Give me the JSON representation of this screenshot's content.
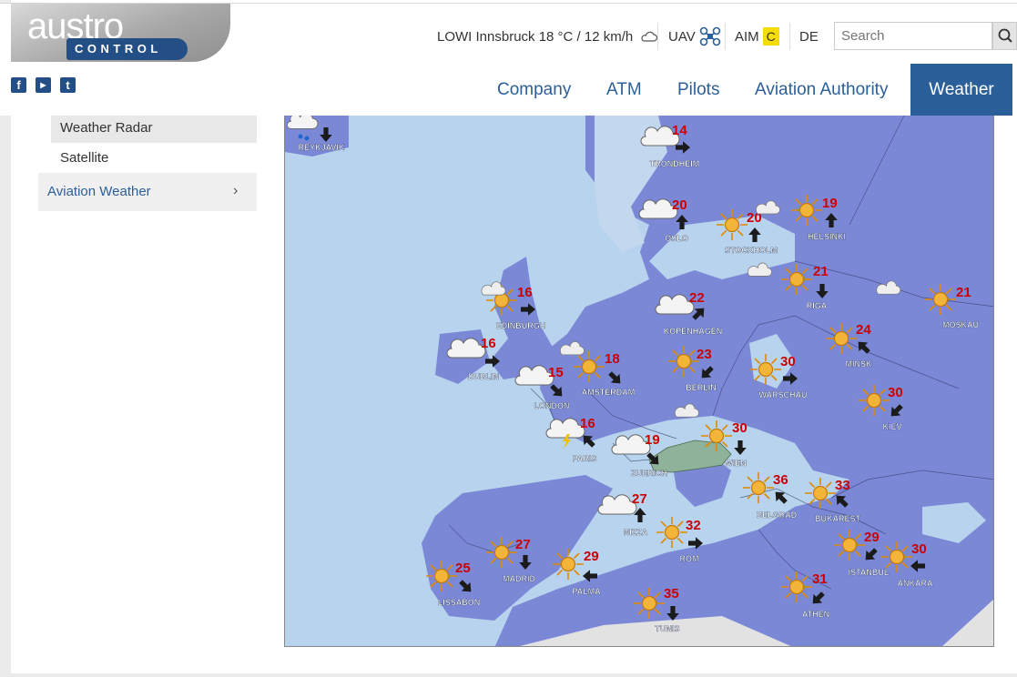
{
  "logo": {
    "word": "austro",
    "sub": "CONTROL"
  },
  "social": {
    "facebook": "f",
    "youtube": "▶",
    "twitter": "t"
  },
  "header": {
    "weather_text": "LOWI Innsbruck 18 °C / 12 km/h",
    "uav_label": "UAV",
    "aim_label": "AIM",
    "aim_status": "C",
    "language": "DE",
    "search_placeholder": "Search"
  },
  "nav": {
    "items": [
      "Company",
      "ATM",
      "Pilots",
      "Aviation Authority",
      "Weather"
    ],
    "active": "Weather"
  },
  "sidebar": {
    "items": [
      {
        "label": "Weather Radar",
        "active": true
      },
      {
        "label": "Satellite",
        "active": false
      }
    ],
    "section": "Aviation Weather"
  },
  "map": {
    "stations": [
      {
        "name": "REYKJAVIK",
        "temp": "",
        "weather": "snow"
      },
      {
        "name": "TRONDHEIM",
        "temp": "14",
        "weather": "cloudy"
      },
      {
        "name": "OSLO",
        "temp": "20",
        "weather": "cloudy"
      },
      {
        "name": "STOCKHOLM",
        "temp": "20",
        "weather": "sunny"
      },
      {
        "name": "HELSINKI",
        "temp": "19",
        "weather": "sunny"
      },
      {
        "name": "RIGA",
        "temp": "21",
        "weather": "sunny"
      },
      {
        "name": "MOSKAU",
        "temp": "21",
        "weather": "sunny"
      },
      {
        "name": "EDINBURGH",
        "temp": "16",
        "weather": "sunny"
      },
      {
        "name": "KOPENHAGEN",
        "temp": "22",
        "weather": "cloudy"
      },
      {
        "name": "DUBLIN",
        "temp": "16",
        "weather": "cloudy"
      },
      {
        "name": "LONDON",
        "temp": "15",
        "weather": "cloudy"
      },
      {
        "name": "AMSTERDAM",
        "temp": "18",
        "weather": "sunny"
      },
      {
        "name": "BERLIN",
        "temp": "23",
        "weather": "sunny"
      },
      {
        "name": "WARSCHAU",
        "temp": "30",
        "weather": "sunny"
      },
      {
        "name": "MINSK",
        "temp": "24",
        "weather": "sunny"
      },
      {
        "name": "KIEV",
        "temp": "30",
        "weather": "sunny"
      },
      {
        "name": "PARIS",
        "temp": "16",
        "weather": "thunder"
      },
      {
        "name": "ZUERICH",
        "temp": "19",
        "weather": "cloudy"
      },
      {
        "name": "WIEN",
        "temp": "30",
        "weather": "sunny"
      },
      {
        "name": "BELGRAD",
        "temp": "36",
        "weather": "sunny"
      },
      {
        "name": "BUKAREST",
        "temp": "33",
        "weather": "sunny"
      },
      {
        "name": "NIZZA",
        "temp": "27",
        "weather": "cloudy"
      },
      {
        "name": "ROM",
        "temp": "32",
        "weather": "sunny"
      },
      {
        "name": "MADRID",
        "temp": "27",
        "weather": "sunny"
      },
      {
        "name": "PALMA",
        "temp": "29",
        "weather": "sunny"
      },
      {
        "name": "LISSABON",
        "temp": "25",
        "weather": "sunny"
      },
      {
        "name": "TUNIS",
        "temp": "35",
        "weather": "sunny"
      },
      {
        "name": "ISTANBUL",
        "temp": "29",
        "weather": "sunny"
      },
      {
        "name": "ANKARA",
        "temp": "30",
        "weather": "sunny"
      },
      {
        "name": "ATHEN",
        "temp": "31",
        "weather": "sunny"
      }
    ]
  }
}
